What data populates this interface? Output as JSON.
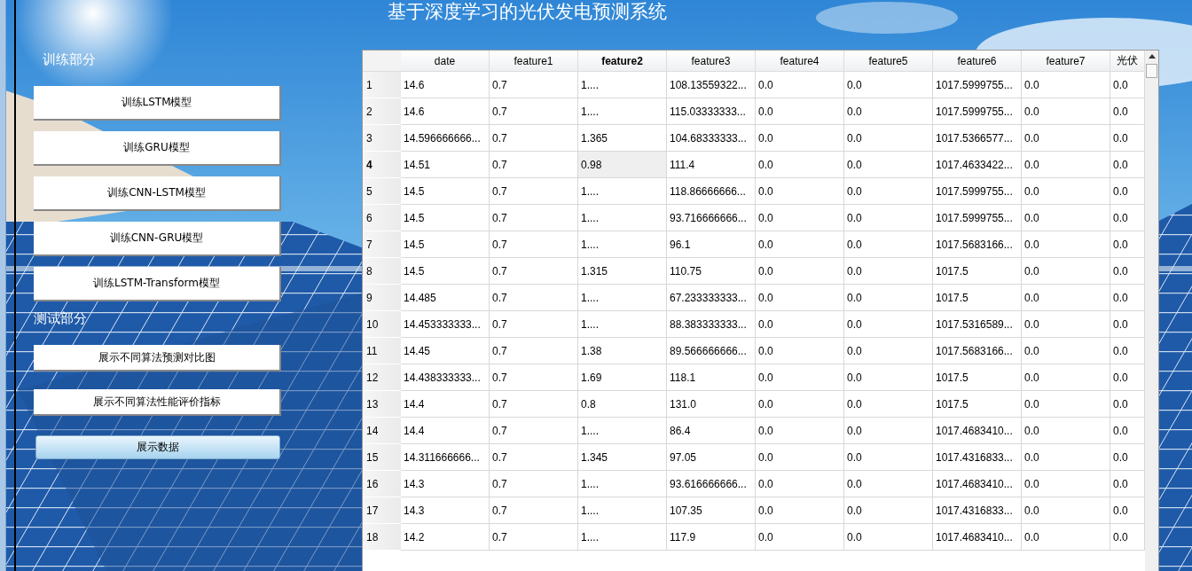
{
  "window": {
    "title": "基于深度学习的光伏发电预测系统"
  },
  "sections": [
    {
      "title": "训练部分",
      "buttons": [
        {
          "label": "训练LSTM模型",
          "kind": "plain"
        },
        {
          "label": "训练GRU模型",
          "kind": "plain"
        },
        {
          "label": "训练CNN-LSTM模型",
          "kind": "plain"
        },
        {
          "label": "训练CNN-GRU模型",
          "kind": "plain"
        },
        {
          "label": "训练LSTM-Transform模型",
          "kind": "plain"
        }
      ]
    },
    {
      "title": "测试部分",
      "buttons": [
        {
          "label": "展示不同算法预测对比图",
          "kind": "plain"
        },
        {
          "label": "展示不同算法性能评价指标",
          "kind": "plain"
        },
        {
          "label": "展示数据",
          "kind": "primary"
        }
      ]
    }
  ],
  "table": {
    "columns": [
      {
        "label": "date",
        "selected": false
      },
      {
        "label": "feature1",
        "selected": false
      },
      {
        "label": "feature2",
        "selected": true
      },
      {
        "label": "feature3",
        "selected": false
      },
      {
        "label": "feature4",
        "selected": false
      },
      {
        "label": "feature5",
        "selected": false
      },
      {
        "label": "feature6",
        "selected": false
      },
      {
        "label": "feature7",
        "selected": false
      },
      {
        "label": "光伏",
        "selected": false
      }
    ],
    "rows": [
      {
        "header": "1",
        "selected": false,
        "cells": [
          "14.6",
          "0.7",
          "1....",
          "108.13559322...",
          "0.0",
          "0.0",
          "1017.5999755...",
          "0.0",
          "0.0"
        ]
      },
      {
        "header": "2",
        "selected": false,
        "cells": [
          "14.6",
          "0.7",
          "1....",
          "115.03333333...",
          "0.0",
          "0.0",
          "1017.5999755...",
          "0.0",
          "0.0"
        ]
      },
      {
        "header": "3",
        "selected": false,
        "cells": [
          "14.596666666...",
          "0.7",
          "1.365",
          "104.68333333...",
          "0.0",
          "0.0",
          "1017.5366577...",
          "0.0",
          "0.0"
        ]
      },
      {
        "header": "4",
        "selected": true,
        "cells": [
          "14.51",
          "0.7",
          "0.98",
          "111.4",
          "0.0",
          "0.0",
          "1017.4633422...",
          "0.0",
          "0.0"
        ]
      },
      {
        "header": "5",
        "selected": false,
        "cells": [
          "14.5",
          "0.7",
          "1....",
          "118.86666666...",
          "0.0",
          "0.0",
          "1017.5999755...",
          "0.0",
          "0.0"
        ]
      },
      {
        "header": "6",
        "selected": false,
        "cells": [
          "14.5",
          "0.7",
          "1....",
          "93.716666666...",
          "0.0",
          "0.0",
          "1017.5999755...",
          "0.0",
          "0.0"
        ]
      },
      {
        "header": "7",
        "selected": false,
        "cells": [
          "14.5",
          "0.7",
          "1....",
          "96.1",
          "0.0",
          "0.0",
          "1017.5683166...",
          "0.0",
          "0.0"
        ]
      },
      {
        "header": "8",
        "selected": false,
        "cells": [
          "14.5",
          "0.7",
          "1.315",
          "110.75",
          "0.0",
          "0.0",
          "1017.5",
          "0.0",
          "0.0"
        ]
      },
      {
        "header": "9",
        "selected": false,
        "cells": [
          "14.485",
          "0.7",
          "1....",
          "67.233333333...",
          "0.0",
          "0.0",
          "1017.5",
          "0.0",
          "0.0"
        ]
      },
      {
        "header": "10",
        "selected": false,
        "cells": [
          "14.453333333...",
          "0.7",
          "1....",
          "88.383333333...",
          "0.0",
          "0.0",
          "1017.5316589...",
          "0.0",
          "0.0"
        ]
      },
      {
        "header": "11",
        "selected": false,
        "cells": [
          "14.45",
          "0.7",
          "1.38",
          "89.566666666...",
          "0.0",
          "0.0",
          "1017.5683166...",
          "0.0",
          "0.0"
        ]
      },
      {
        "header": "12",
        "selected": false,
        "cells": [
          "14.438333333...",
          "0.7",
          "1.69",
          "118.1",
          "0.0",
          "0.0",
          "1017.5",
          "0.0",
          "0.0"
        ]
      },
      {
        "header": "13",
        "selected": false,
        "cells": [
          "14.4",
          "0.7",
          "0.8",
          "131.0",
          "0.0",
          "0.0",
          "1017.5",
          "0.0",
          "0.0"
        ]
      },
      {
        "header": "14",
        "selected": false,
        "cells": [
          "14.4",
          "0.7",
          "1....",
          "86.4",
          "0.0",
          "0.0",
          "1017.4683410...",
          "0.0",
          "0.0"
        ]
      },
      {
        "header": "15",
        "selected": false,
        "cells": [
          "14.311666666...",
          "0.7",
          "1.345",
          "97.05",
          "0.0",
          "0.0",
          "1017.4316833...",
          "0.0",
          "0.0"
        ]
      },
      {
        "header": "16",
        "selected": false,
        "cells": [
          "14.3",
          "0.7",
          "1....",
          "93.616666666...",
          "0.0",
          "0.0",
          "1017.4683410...",
          "0.0",
          "0.0"
        ]
      },
      {
        "header": "17",
        "selected": false,
        "cells": [
          "14.3",
          "0.7",
          "1....",
          "107.35",
          "0.0",
          "0.0",
          "1017.4316833...",
          "0.0",
          "0.0"
        ]
      },
      {
        "header": "18",
        "selected": false,
        "cells": [
          "14.2",
          "0.7",
          "1....",
          "117.9",
          "0.0",
          "0.0",
          "1017.4683410...",
          "0.0",
          "0.0"
        ]
      }
    ]
  }
}
